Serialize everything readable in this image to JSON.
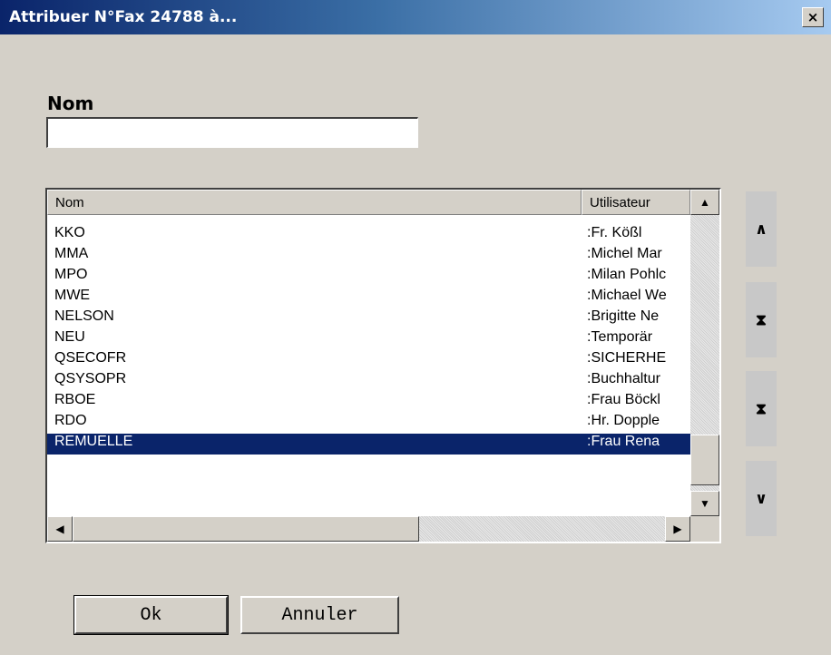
{
  "window": {
    "title": "Attribuer N°Fax 24788 à...",
    "close_glyph": "×"
  },
  "form": {
    "name_label": "Nom",
    "name_value": ""
  },
  "list": {
    "columns": [
      "Nom",
      "Utilisateur"
    ],
    "rows": [
      {
        "nom": "KKO",
        "user": ":Fr. Kößl"
      },
      {
        "nom": "MMA",
        "user": ":Michel Mar"
      },
      {
        "nom": "MPO",
        "user": ":Milan Pohlc"
      },
      {
        "nom": "MWE",
        "user": ":Michael We"
      },
      {
        "nom": "NELSON",
        "user": ":Brigitte Ne"
      },
      {
        "nom": "NEU",
        "user": ":Temporär"
      },
      {
        "nom": "QSECOFR",
        "user": ":SICHERHE"
      },
      {
        "nom": "QSYSOPR",
        "user": ":Buchhaltur"
      },
      {
        "nom": "RBOE",
        "user": ":Frau Böckl"
      },
      {
        "nom": "RDO",
        "user": ":Hr. Dopple"
      },
      {
        "nom": "REMUELLE",
        "user": ":Frau Rena"
      }
    ],
    "selected_index": 10
  },
  "nav": {
    "buttons": [
      {
        "name": "scroll-up-button",
        "icon": "chevron-up-icon",
        "glyph": "∧"
      },
      {
        "name": "scroll-top-button",
        "icon": "first-record-icon",
        "glyph": "⧗"
      },
      {
        "name": "scroll-bottom-button",
        "icon": "last-record-icon",
        "glyph": "⧗"
      },
      {
        "name": "scroll-down-button",
        "icon": "chevron-down-icon",
        "glyph": "∨"
      }
    ]
  },
  "buttons": {
    "ok": "Ok",
    "cancel": "Annuler"
  }
}
